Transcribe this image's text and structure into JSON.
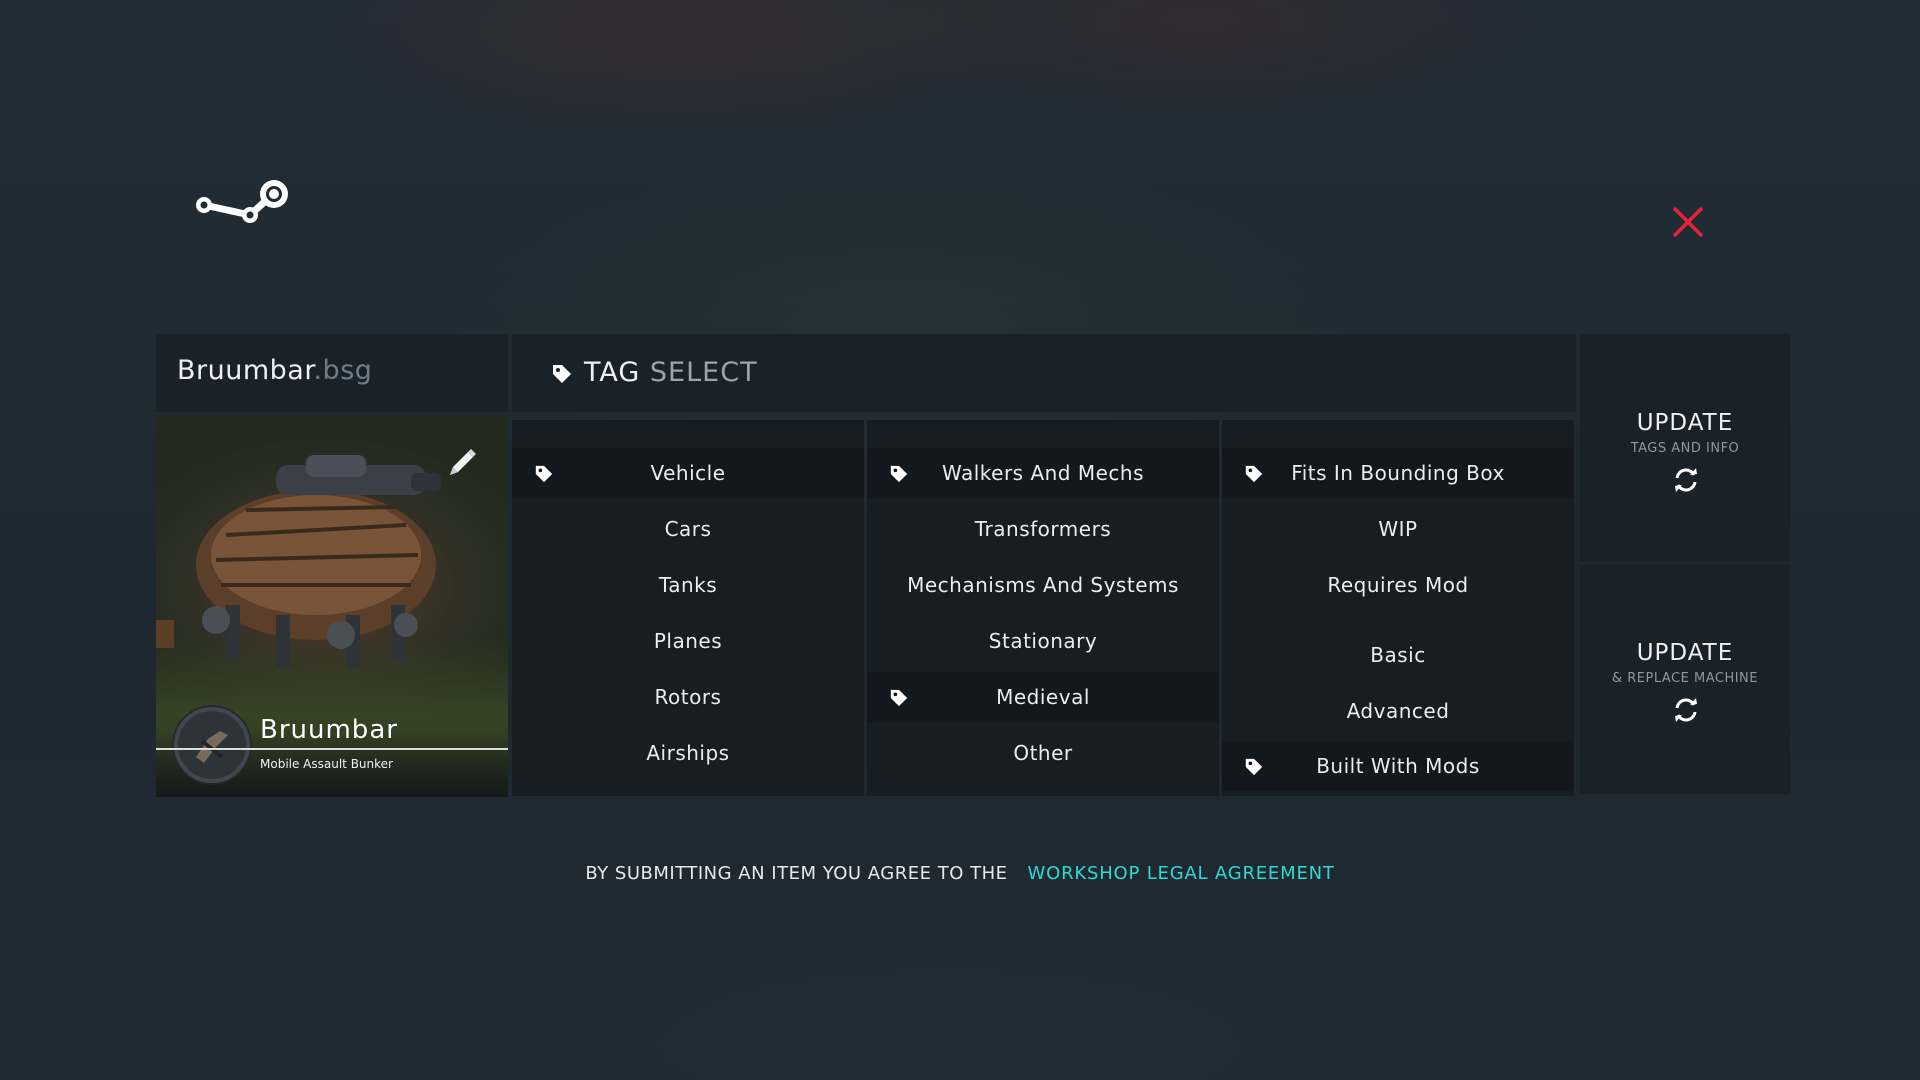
{
  "machine": {
    "filename": "Bruumbar",
    "extension": ".bsg",
    "name": "Bruumbar",
    "subtitle": "Mobile Assault Bunker"
  },
  "tag_select": {
    "title_bold": "TAG",
    "title_light": "SELECT",
    "columns": [
      {
        "items": [
          {
            "label": "Vehicle",
            "selected": true
          },
          {
            "label": "Cars",
            "selected": false
          },
          {
            "label": "Tanks",
            "selected": false
          },
          {
            "label": "Planes",
            "selected": false
          },
          {
            "label": "Rotors",
            "selected": false
          },
          {
            "label": "Airships",
            "selected": false
          }
        ]
      },
      {
        "items": [
          {
            "label": "Walkers And Mechs",
            "selected": true
          },
          {
            "label": "Transformers",
            "selected": false
          },
          {
            "label": "Mechanisms And Systems",
            "selected": false
          },
          {
            "label": "Stationary",
            "selected": false
          },
          {
            "label": "Medieval",
            "selected": true
          },
          {
            "label": "Other",
            "selected": false
          }
        ]
      },
      {
        "items": [
          {
            "label": "Fits In Bounding Box",
            "selected": true
          },
          {
            "label": "WIP",
            "selected": false
          },
          {
            "label": "Requires Mod",
            "selected": false
          },
          {
            "label": "Basic",
            "selected": false
          },
          {
            "label": "Advanced",
            "selected": false
          },
          {
            "label": "Built With Mods",
            "selected": true
          }
        ]
      }
    ]
  },
  "actions": {
    "update_tags": {
      "title": "UPDATE",
      "subtitle": "TAGS AND INFO",
      "icon": "refresh-icon"
    },
    "update_replace": {
      "title": "UPDATE",
      "subtitle": "& REPLACE MACHINE",
      "icon": "refresh-icon"
    }
  },
  "legal": {
    "text": "BY SUBMITTING AN ITEM YOU AGREE TO THE",
    "link": "WORKSHOP LEGAL AGREEMENT"
  },
  "colors": {
    "accent_link": "#2fd9d2",
    "close": "#e8203c",
    "background": "#1f2a33"
  },
  "icons": [
    "steam-logo",
    "close-icon",
    "tag-icon",
    "pencil-icon",
    "refresh-icon",
    "badge-icon"
  ]
}
